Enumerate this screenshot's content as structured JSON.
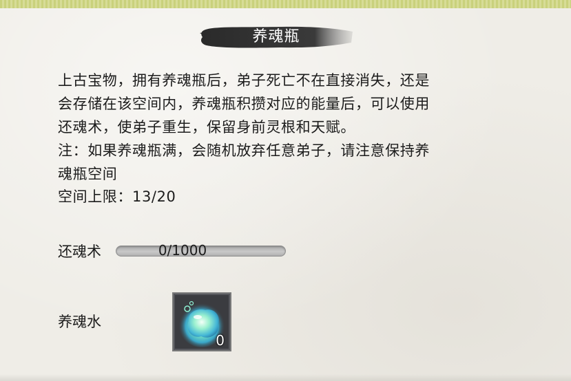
{
  "title": "养魂瓶",
  "description": {
    "lines": [
      "上古宝物，拥有养魂瓶后，弟子死亡不在直接消失，还是",
      "会存储在该空间内，养魂瓶积攒对应的能量后，可以使用",
      "还魂术，使弟子重生，保留身前灵根和天赋。",
      "注：如果养魂瓶满，会随机放弃任意弟子，请注意保持养",
      "魂瓶空间"
    ]
  },
  "capacity_text": "空间上限：13/20",
  "revive": {
    "label": "还魂术",
    "progress_text": "0/1000",
    "progress_fraction": 0
  },
  "item": {
    "label": "养魂水",
    "count": "0",
    "icon": "soul-water-icon"
  },
  "colors": {
    "top_border": "#c9d17c",
    "paper": "#efede7",
    "title_brush": "#3a3a3a"
  }
}
